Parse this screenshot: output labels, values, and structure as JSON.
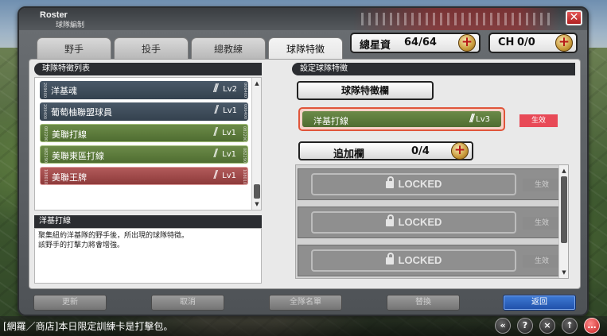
{
  "window": {
    "title_en": "Roster",
    "title_zh": "球隊編制",
    "close_label": "✕"
  },
  "tabs": [
    {
      "label": "野手",
      "active": false
    },
    {
      "label": "投手",
      "active": false
    },
    {
      "label": "總教練",
      "active": false
    },
    {
      "label": "球隊特徵",
      "active": true
    }
  ],
  "currency": {
    "stars_label": "總星資",
    "stars_value": "64/64",
    "ch_label": "CH",
    "ch_value": "0/0",
    "plus_label": "+"
  },
  "left_panel": {
    "section_title": "球隊特徵列表",
    "items": [
      {
        "name": "洋基魂",
        "level": "Lv2",
        "color": "navy",
        "tag_left": "209400",
        "tag_right": "006400"
      },
      {
        "name": "葡萄柚聯盟球員",
        "level": "Lv1",
        "color": "navy",
        "tag_left": "209400",
        "tag_right": "006400"
      },
      {
        "name": "美聯打線",
        "level": "Lv1",
        "color": "green",
        "tag_left": "082290",
        "tag_right": "082290"
      },
      {
        "name": "美聯東區打線",
        "level": "Lv1",
        "color": "green",
        "tag_left": "082290",
        "tag_right": "082290"
      },
      {
        "name": "美聯王牌",
        "level": "Lv1",
        "color": "red",
        "tag_left": "108010",
        "tag_right": "108010"
      }
    ],
    "desc_title": "洋基打線",
    "desc_lines": [
      "聚集紐約洋基隊的野手後，所出現的球隊特徵。",
      "該野手的打擊力將會增強。"
    ]
  },
  "right_panel": {
    "section_title": "設定球隊特徵",
    "slot_header": "球隊特徵欄",
    "equipped": {
      "name": "洋基打線",
      "level": "Lv3",
      "status": "生效",
      "tag_left": "082290",
      "tag_right": "082290"
    },
    "add_label": "追加欄",
    "add_count": "0/4",
    "locked_rows": [
      {
        "label": "LOCKED",
        "status": "生效"
      },
      {
        "label": "LOCKED",
        "status": "生效"
      },
      {
        "label": "LOCKED",
        "status": "生效"
      }
    ]
  },
  "buttons": {
    "update": "更新",
    "cancel": "取消",
    "full_roster": "全隊名單",
    "replace": "替換",
    "back": "返回"
  },
  "statusbar": {
    "ticker": "[網羅／商店]本日限定訓練卡是打擊包。",
    "icons": [
      "rewind-icon",
      "help-icon",
      "mute-icon",
      "up-arrow-icon",
      "chat-icon"
    ]
  },
  "colors": {
    "accent_red": "#e84a57",
    "primary_blue": "#1f4fa8",
    "trait_green": "#5d7c3c",
    "trait_navy": "#3e4b58",
    "trait_red": "#9e4a4a"
  }
}
